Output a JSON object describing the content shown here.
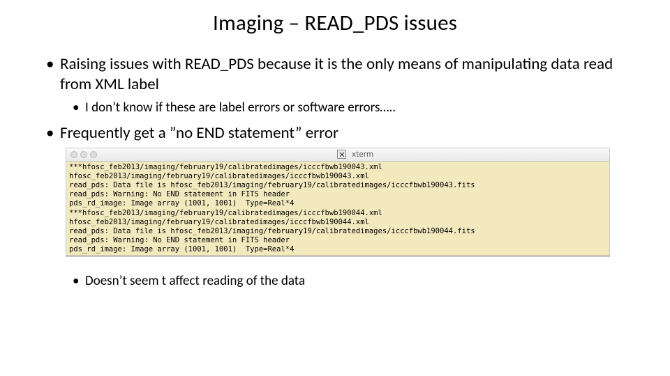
{
  "title": "Imaging – READ_PDS issues",
  "bullets": {
    "b1": "Raising issues with READ_PDS because it is the only means of manipulating data read from XML label",
    "b1_sub": "I don’t know if these are label errors or software errors…..",
    "b2": "Frequently get a ”no END statement” error",
    "b3_sub": "Doesn’t seem t affect reading of the data"
  },
  "terminal": {
    "window_label": "xterm",
    "lines": [
      "***hfosc_feb2013/imaging/february19/calibratedimages/icccfbwb190043.xml",
      "hfosc_feb2013/imaging/february19/calibratedimages/icccfbwb190043.xml",
      "read_pds: Data file is hfosc_feb2013/imaging/february19/calibratedimages/icccfbwb190043.fits",
      "read_pds: Warning: No END statement in FITS header",
      "pds_rd_image: Image array (1001, 1001)  Type=Real*4",
      "***hfosc_feb2013/imaging/february19/calibratedimages/icccfbwb190044.xml",
      "hfosc_feb2013/imaging/february19/calibratedimages/icccfbwb190044.xml",
      "read_pds: Data file is hfosc_feb2013/imaging/february19/calibratedimages/icccfbwb190044.fits",
      "read_pds: Warning: No END statement in FITS header",
      "pds_rd_image: Image array (1001, 1001)  Type=Real*4"
    ]
  }
}
